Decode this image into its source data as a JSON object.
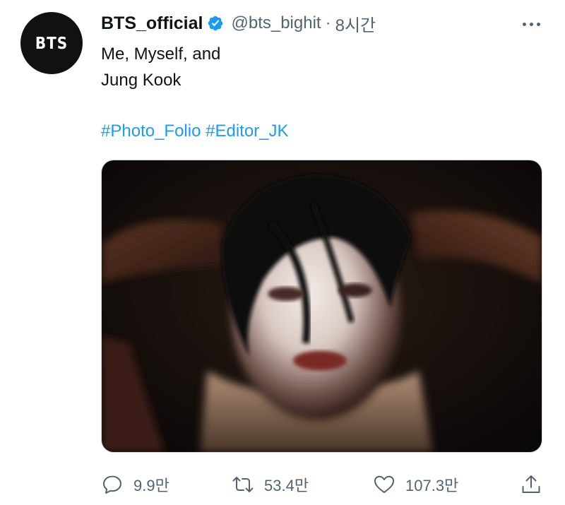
{
  "tweet": {
    "avatar_text": "BTS",
    "display_name": "BTS_official",
    "verified": true,
    "handle": "@bts_bighit",
    "separator": "·",
    "time": "8시간",
    "text_lines": [
      "Me, Myself, and",
      "Jung Kook"
    ],
    "hashtags": [
      "#Photo_Folio",
      "#Editor_JK"
    ]
  },
  "actions": {
    "reply": {
      "icon": "reply-bubble-icon",
      "count": "9.9만"
    },
    "retweet": {
      "icon": "retweet-icon",
      "count": "53.4만"
    },
    "like": {
      "icon": "heart-icon",
      "count": "107.3만"
    },
    "share": {
      "icon": "share-upload-icon"
    }
  },
  "colors": {
    "link": "#1d9bf0",
    "secondary_text": "#536471",
    "primary_text": "#0f1419",
    "avatar_bg": "#111111"
  }
}
